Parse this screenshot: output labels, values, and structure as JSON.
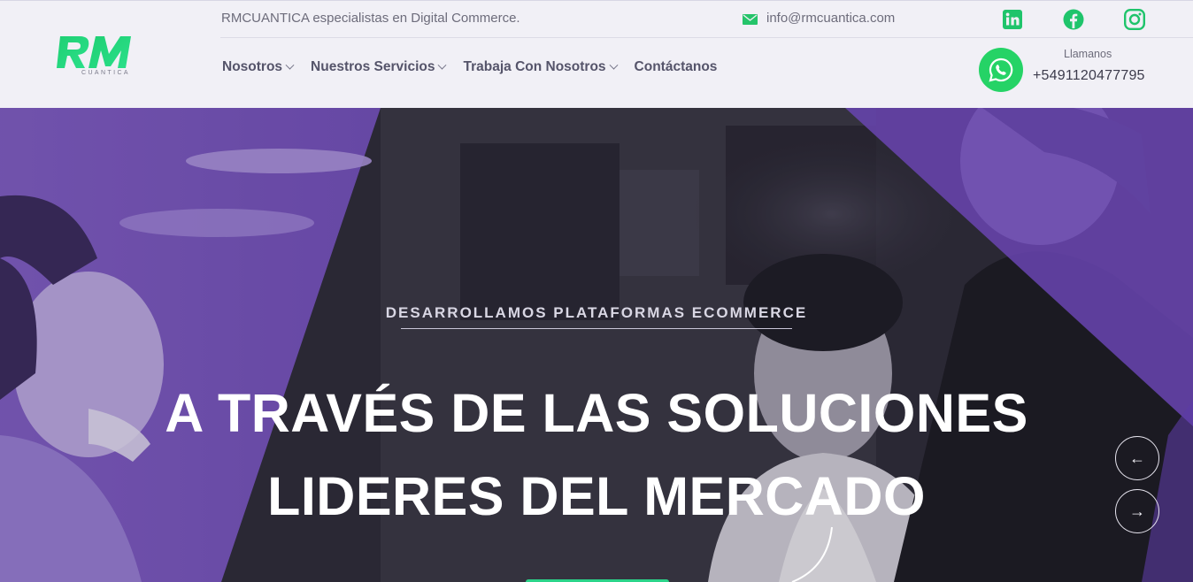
{
  "header": {
    "logo_text": "RM",
    "logo_subtext": "CUANTICA",
    "tagline": "RMCUANTICA especialistas en Digital Commerce.",
    "email": "info@rmcuantica.com",
    "social": [
      {
        "name": "linkedin",
        "icon": "linkedin-icon"
      },
      {
        "name": "facebook",
        "icon": "facebook-icon"
      },
      {
        "name": "instagram",
        "icon": "instagram-icon"
      }
    ],
    "nav": [
      {
        "label": "Nosotros",
        "dropdown": true
      },
      {
        "label": "Nuestros Servicios",
        "dropdown": true
      },
      {
        "label": "Trabaja Con Nosotros",
        "dropdown": true
      },
      {
        "label": "Contáctanos",
        "dropdown": false
      }
    ],
    "call_label": "Llamanos",
    "phone": "+5491120477795"
  },
  "hero": {
    "kicker": "DESARROLLAMOS PLATAFORMAS ECOMMERCE",
    "title_line1": "A TRAVÉS DE LAS SOLUCIONES",
    "title_line2": "LIDERES DEL MERCADO",
    "prev_arrow": "←",
    "next_arrow": "→"
  },
  "colors": {
    "brand_green": "#25d366",
    "accent_purple": "#7a4fd0",
    "header_bg": "#f1f0f6"
  }
}
